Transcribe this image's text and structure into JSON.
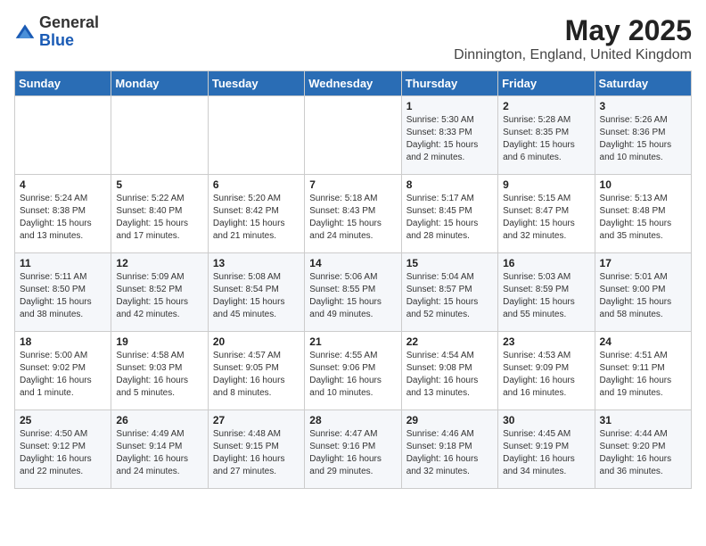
{
  "header": {
    "logo_general": "General",
    "logo_blue": "Blue",
    "title": "May 2025",
    "subtitle": "Dinnington, England, United Kingdom"
  },
  "weekdays": [
    "Sunday",
    "Monday",
    "Tuesday",
    "Wednesday",
    "Thursday",
    "Friday",
    "Saturday"
  ],
  "weeks": [
    [
      {
        "day": "",
        "info": ""
      },
      {
        "day": "",
        "info": ""
      },
      {
        "day": "",
        "info": ""
      },
      {
        "day": "",
        "info": ""
      },
      {
        "day": "1",
        "info": "Sunrise: 5:30 AM\nSunset: 8:33 PM\nDaylight: 15 hours\nand 2 minutes."
      },
      {
        "day": "2",
        "info": "Sunrise: 5:28 AM\nSunset: 8:35 PM\nDaylight: 15 hours\nand 6 minutes."
      },
      {
        "day": "3",
        "info": "Sunrise: 5:26 AM\nSunset: 8:36 PM\nDaylight: 15 hours\nand 10 minutes."
      }
    ],
    [
      {
        "day": "4",
        "info": "Sunrise: 5:24 AM\nSunset: 8:38 PM\nDaylight: 15 hours\nand 13 minutes."
      },
      {
        "day": "5",
        "info": "Sunrise: 5:22 AM\nSunset: 8:40 PM\nDaylight: 15 hours\nand 17 minutes."
      },
      {
        "day": "6",
        "info": "Sunrise: 5:20 AM\nSunset: 8:42 PM\nDaylight: 15 hours\nand 21 minutes."
      },
      {
        "day": "7",
        "info": "Sunrise: 5:18 AM\nSunset: 8:43 PM\nDaylight: 15 hours\nand 24 minutes."
      },
      {
        "day": "8",
        "info": "Sunrise: 5:17 AM\nSunset: 8:45 PM\nDaylight: 15 hours\nand 28 minutes."
      },
      {
        "day": "9",
        "info": "Sunrise: 5:15 AM\nSunset: 8:47 PM\nDaylight: 15 hours\nand 32 minutes."
      },
      {
        "day": "10",
        "info": "Sunrise: 5:13 AM\nSunset: 8:48 PM\nDaylight: 15 hours\nand 35 minutes."
      }
    ],
    [
      {
        "day": "11",
        "info": "Sunrise: 5:11 AM\nSunset: 8:50 PM\nDaylight: 15 hours\nand 38 minutes."
      },
      {
        "day": "12",
        "info": "Sunrise: 5:09 AM\nSunset: 8:52 PM\nDaylight: 15 hours\nand 42 minutes."
      },
      {
        "day": "13",
        "info": "Sunrise: 5:08 AM\nSunset: 8:54 PM\nDaylight: 15 hours\nand 45 minutes."
      },
      {
        "day": "14",
        "info": "Sunrise: 5:06 AM\nSunset: 8:55 PM\nDaylight: 15 hours\nand 49 minutes."
      },
      {
        "day": "15",
        "info": "Sunrise: 5:04 AM\nSunset: 8:57 PM\nDaylight: 15 hours\nand 52 minutes."
      },
      {
        "day": "16",
        "info": "Sunrise: 5:03 AM\nSunset: 8:59 PM\nDaylight: 15 hours\nand 55 minutes."
      },
      {
        "day": "17",
        "info": "Sunrise: 5:01 AM\nSunset: 9:00 PM\nDaylight: 15 hours\nand 58 minutes."
      }
    ],
    [
      {
        "day": "18",
        "info": "Sunrise: 5:00 AM\nSunset: 9:02 PM\nDaylight: 16 hours\nand 1 minute."
      },
      {
        "day": "19",
        "info": "Sunrise: 4:58 AM\nSunset: 9:03 PM\nDaylight: 16 hours\nand 5 minutes."
      },
      {
        "day": "20",
        "info": "Sunrise: 4:57 AM\nSunset: 9:05 PM\nDaylight: 16 hours\nand 8 minutes."
      },
      {
        "day": "21",
        "info": "Sunrise: 4:55 AM\nSunset: 9:06 PM\nDaylight: 16 hours\nand 10 minutes."
      },
      {
        "day": "22",
        "info": "Sunrise: 4:54 AM\nSunset: 9:08 PM\nDaylight: 16 hours\nand 13 minutes."
      },
      {
        "day": "23",
        "info": "Sunrise: 4:53 AM\nSunset: 9:09 PM\nDaylight: 16 hours\nand 16 minutes."
      },
      {
        "day": "24",
        "info": "Sunrise: 4:51 AM\nSunset: 9:11 PM\nDaylight: 16 hours\nand 19 minutes."
      }
    ],
    [
      {
        "day": "25",
        "info": "Sunrise: 4:50 AM\nSunset: 9:12 PM\nDaylight: 16 hours\nand 22 minutes."
      },
      {
        "day": "26",
        "info": "Sunrise: 4:49 AM\nSunset: 9:14 PM\nDaylight: 16 hours\nand 24 minutes."
      },
      {
        "day": "27",
        "info": "Sunrise: 4:48 AM\nSunset: 9:15 PM\nDaylight: 16 hours\nand 27 minutes."
      },
      {
        "day": "28",
        "info": "Sunrise: 4:47 AM\nSunset: 9:16 PM\nDaylight: 16 hours\nand 29 minutes."
      },
      {
        "day": "29",
        "info": "Sunrise: 4:46 AM\nSunset: 9:18 PM\nDaylight: 16 hours\nand 32 minutes."
      },
      {
        "day": "30",
        "info": "Sunrise: 4:45 AM\nSunset: 9:19 PM\nDaylight: 16 hours\nand 34 minutes."
      },
      {
        "day": "31",
        "info": "Sunrise: 4:44 AM\nSunset: 9:20 PM\nDaylight: 16 hours\nand 36 minutes."
      }
    ]
  ]
}
